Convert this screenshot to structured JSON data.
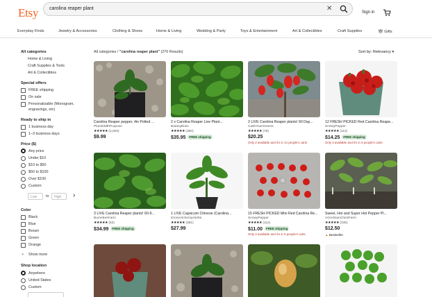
{
  "header": {
    "logo": "Etsy",
    "search_value": "carolina reaper plant",
    "sign_in": "Sign in"
  },
  "catnav": [
    "Everyday Finds",
    "Jewelry & Accessories",
    "Clothing & Shoes",
    "Home & Living",
    "Wedding & Party",
    "Toys & Entertainment",
    "Art & Collectibles",
    "Craft Supplies",
    "Gifts"
  ],
  "sidebar": {
    "categories": {
      "heading": "All categories",
      "items": [
        "Home & Living",
        "Craft Supplies & Tools",
        "Art & Collectibles"
      ]
    },
    "special": {
      "heading": "Special offers",
      "items": [
        "FREE shipping",
        "On sale",
        "Personalizable (Monogram,",
        "engravings, etc)"
      ]
    },
    "ship": {
      "heading": "Ready to ship in",
      "items": [
        "1 business day",
        "1–3 business days"
      ]
    },
    "price": {
      "heading": "Price ($)",
      "items": [
        "Any price",
        "Under $10",
        "$10 to $50",
        "$50 to $100",
        "Over $100",
        "Custom"
      ],
      "low": "Low",
      "to": "to",
      "high": "High"
    },
    "color": {
      "heading": "Color",
      "items": [
        "Black",
        "Blue",
        "Brown",
        "Green",
        "Orange"
      ],
      "show_more": "Show more"
    },
    "location": {
      "heading": "Shop location",
      "items": [
        "Anywhere",
        "United States",
        "Custom"
      ]
    }
  },
  "results": {
    "all_categories": "All categories",
    "query": "\"carolina reaper plant\"",
    "count": "(270 Results)",
    "sort": "Sort by: Relevancy"
  },
  "products": [
    {
      "title": "Carolina Reaper pepper, 4in Potted ...",
      "shop": "PlantsWithPurpose",
      "rating": "(2,004)",
      "price": "$9.99",
      "free": "",
      "note": "",
      "badge": ""
    },
    {
      "title": "2 x Carolina Reaper Live Plant...",
      "shop": "BotanyBoss",
      "rating": "(350)",
      "price": "$35.95",
      "free": "FREE shipping",
      "note": "",
      "badge": ""
    },
    {
      "title": "2 LIVE Carolina Reaper plants! 60 Day...",
      "shop": "CashYourGreens",
      "rating": "(75)",
      "price": "$20.25",
      "free": "",
      "note": "Only 2 available and it's in 14 people's carts",
      "badge": ""
    },
    {
      "title": "12 FRESH PICKED Red Carolina Reape...",
      "shop": "SnowyPepper",
      "rating": "(112)",
      "price": "$14.25",
      "free": "FREE shipping",
      "note": "Only 3 available and it's in 5 people's carts",
      "badge": ""
    },
    {
      "title": "3 LIVE Carolina Reaper plants! 60-9...",
      "shop": "BurnettesFarm",
      "rating": "(62)",
      "price": "$34.99",
      "free": "FREE shipping",
      "note": "",
      "badge": ""
    },
    {
      "title": "1 LIVE Capsicum Chinese (Carolina...",
      "shop": "DroneAlchemyHerbs",
      "rating": "(381)",
      "price": "$27.99",
      "free": "",
      "note": "",
      "badge": ""
    },
    {
      "title": "15 FRESH PICKED Mini Red Carolina Re...",
      "shop": "SnowyPepper",
      "rating": "(112)",
      "price": "$11.00",
      "free": "FREE shipping",
      "note": "Only 3 available and it's in 5 people's carts",
      "badge": ""
    },
    {
      "title": "Sweet, Hot and Super Hot Pepper Pl...",
      "shop": "AGArtisanChickFarm",
      "rating": "(345)",
      "price": "$12.50",
      "free": "",
      "note": "",
      "badge": "Bestseller"
    }
  ],
  "colors": {
    "brand": "#f1641e",
    "free_bg": "#d4e9d7",
    "free_fg": "#1b4d24",
    "urgency": "#b6372c"
  }
}
